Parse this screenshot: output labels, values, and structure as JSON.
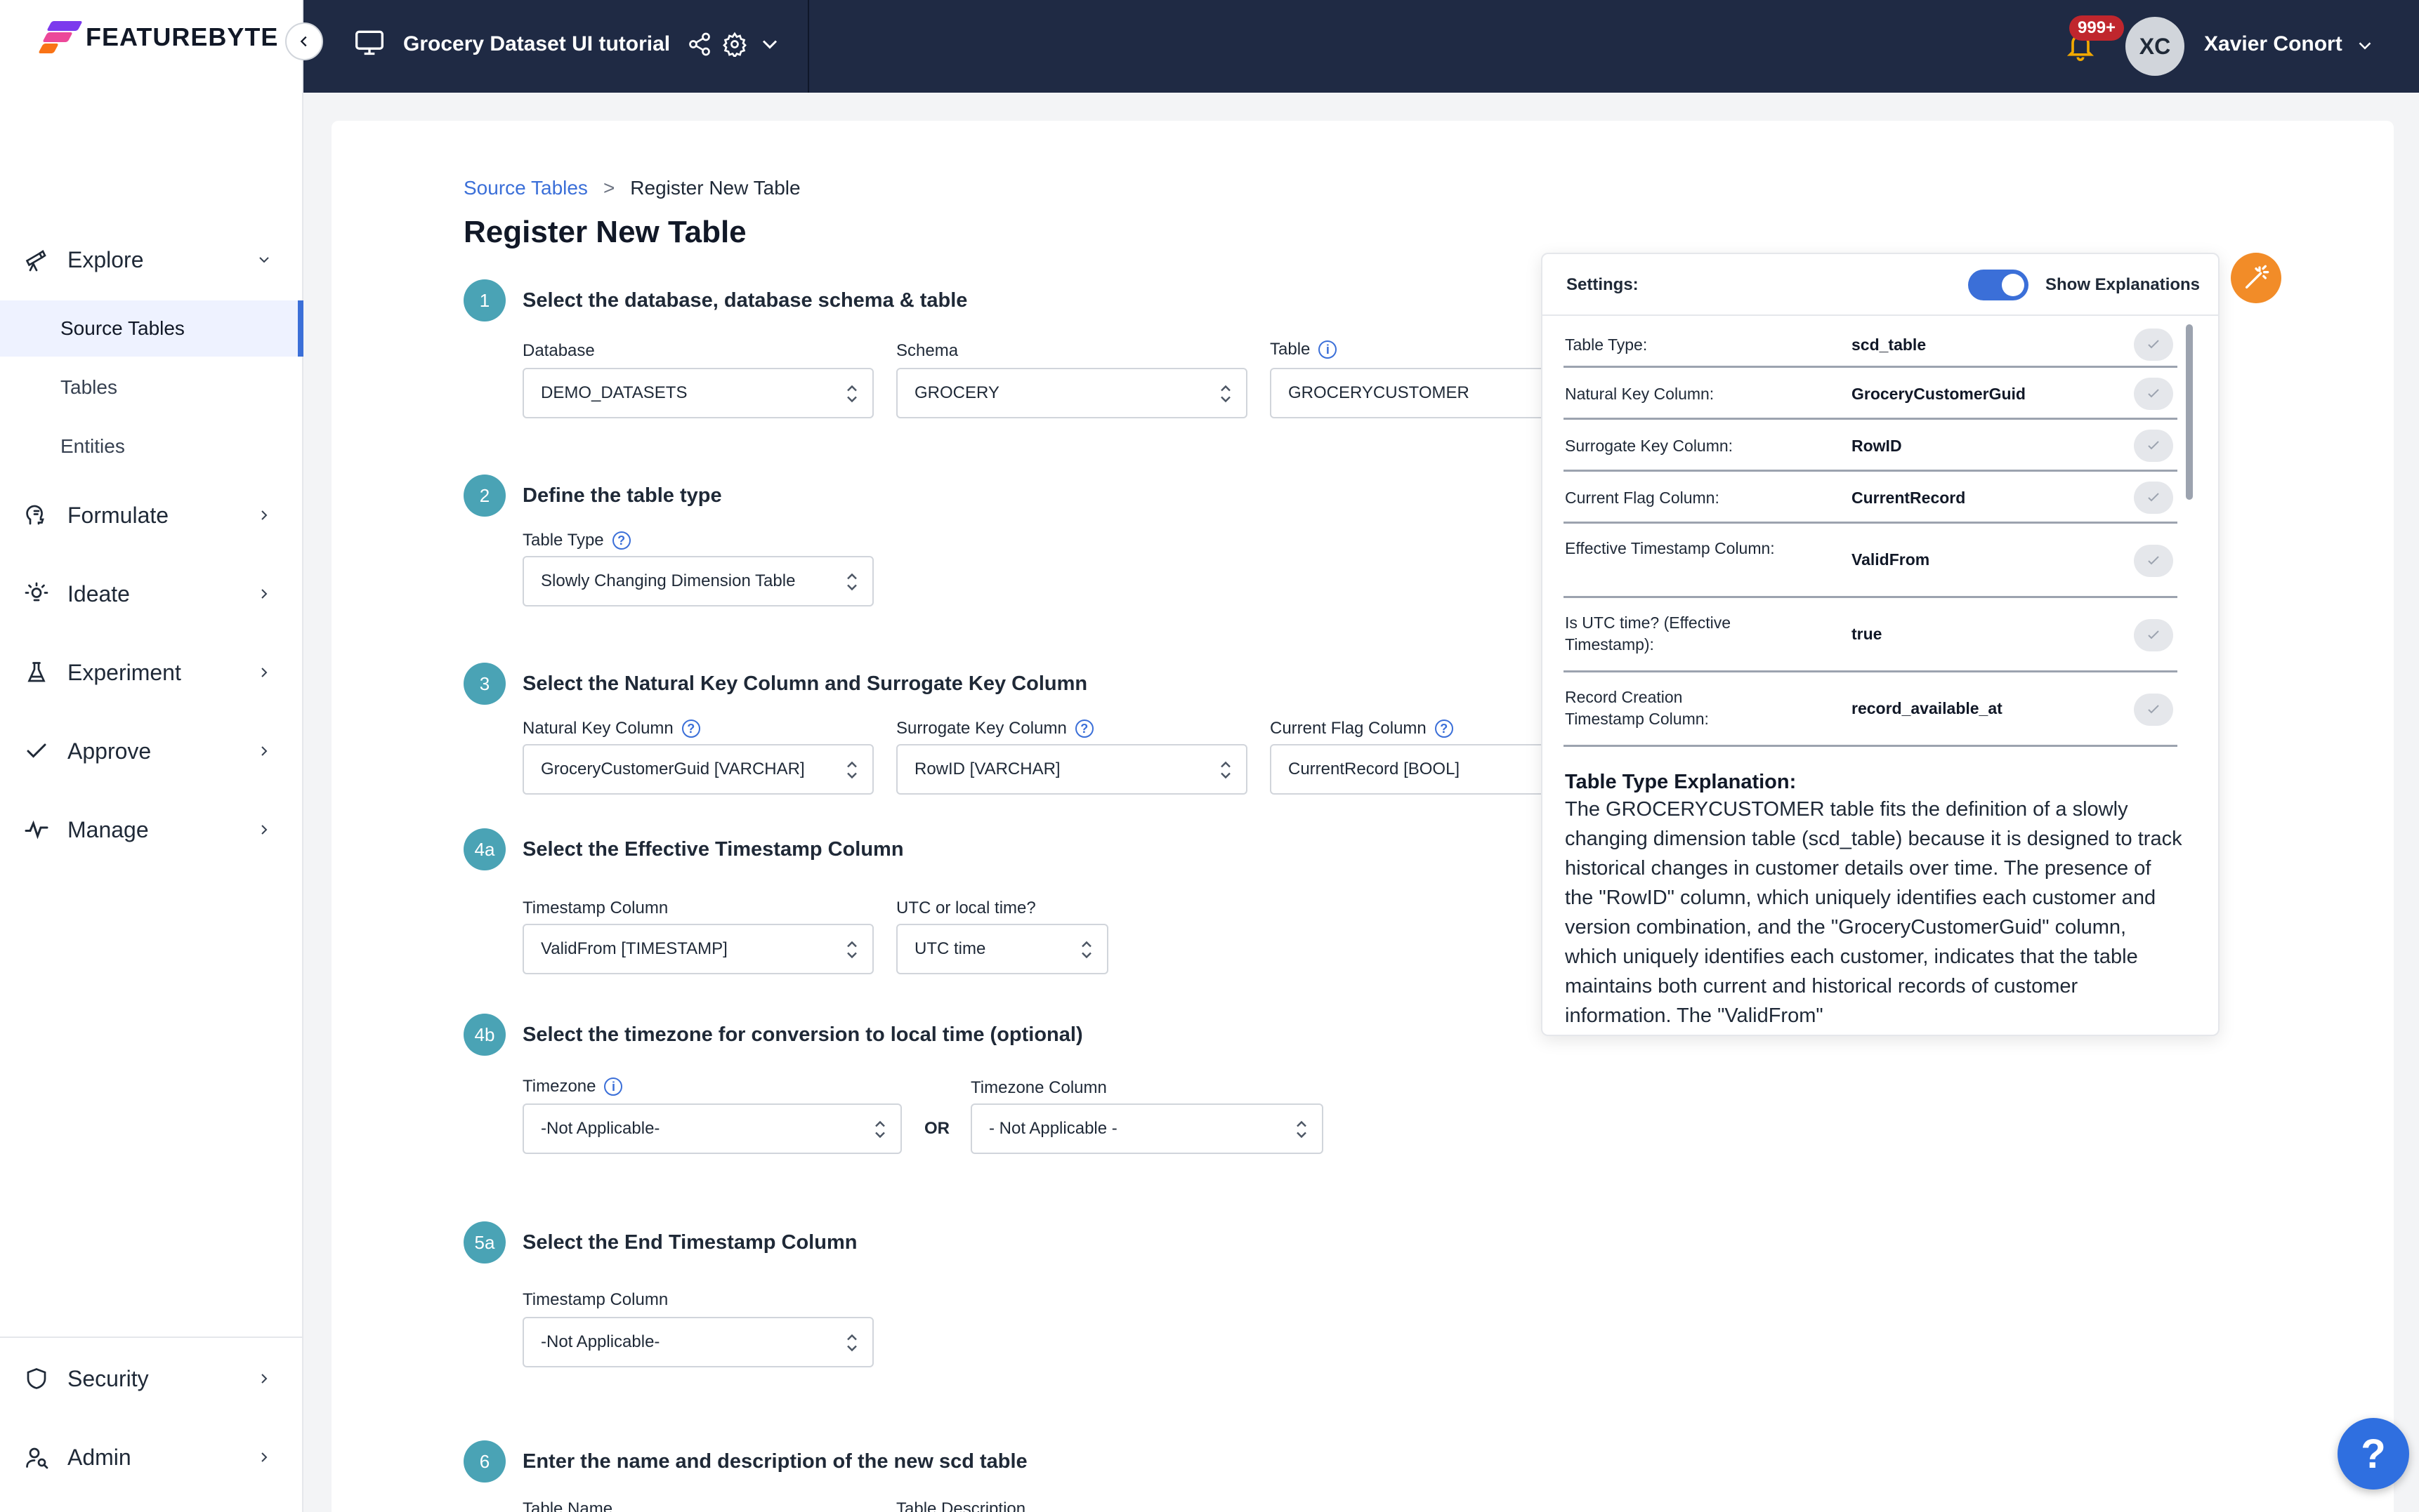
{
  "brand": {
    "logo_text": "FEATUREBYTE"
  },
  "topbar": {
    "project_title": "Grocery Dataset UI tutorial",
    "notification_count": "999+",
    "user_initials": "XC",
    "user_name": "Xavier Conort"
  },
  "sidebar": {
    "explore": "Explore",
    "source_tables": "Source Tables",
    "tables": "Tables",
    "entities": "Entities",
    "formulate": "Formulate",
    "ideate": "Ideate",
    "experiment": "Experiment",
    "approve": "Approve",
    "manage": "Manage",
    "security": "Security",
    "admin": "Admin"
  },
  "breadcrumb": {
    "parent": "Source Tables",
    "separator": ">",
    "current": "Register New Table"
  },
  "page_title": "Register New Table",
  "steps": {
    "s1": {
      "badge": "1",
      "title": "Select the database, database schema & table",
      "database_label": "Database",
      "database_value": "DEMO_DATASETS",
      "schema_label": "Schema",
      "schema_value": "GROCERY",
      "table_label": "Table",
      "table_value": "GROCERYCUSTOMER"
    },
    "s2": {
      "badge": "2",
      "title": "Define the table type",
      "type_label": "Table Type",
      "type_value": "Slowly Changing Dimension Table"
    },
    "s3": {
      "badge": "3",
      "title": "Select the Natural Key Column and Surrogate Key Column",
      "natural_label": "Natural Key Column",
      "natural_value": "GroceryCustomerGuid [VARCHAR]",
      "surrogate_label": "Surrogate Key Column",
      "surrogate_value": "RowID [VARCHAR]",
      "flag_label": "Current Flag Column",
      "flag_value": "CurrentRecord [BOOL]"
    },
    "s4a": {
      "badge": "4a",
      "title": "Select the Effective Timestamp Column",
      "ts_label": "Timestamp Column",
      "ts_value": "ValidFrom  [TIMESTAMP]",
      "utc_label": "UTC or local time?",
      "utc_value": "UTC time"
    },
    "s4b": {
      "badge": "4b",
      "title": "Select the timezone for conversion to local time (optional)",
      "tz_label": "Timezone",
      "tz_value": "-Not Applicable-",
      "or": "OR",
      "tzcol_label": "Timezone Column",
      "tzcol_value": "- Not Applicable -"
    },
    "s5a": {
      "badge": "5a",
      "title": "Select the End Timestamp Column",
      "ts_label": "Timestamp Column",
      "ts_value": "-Not Applicable-"
    },
    "s6": {
      "badge": "6",
      "title": "Enter the name and description of the new scd table",
      "name_label": "Table Name",
      "desc_label": "Table Description"
    }
  },
  "panel": {
    "settings_label": "Settings:",
    "toggle_label": "Show Explanations",
    "rows": [
      {
        "key": "Table Type:",
        "value": "scd_table"
      },
      {
        "key": "Natural Key Column:",
        "value": "GroceryCustomerGuid"
      },
      {
        "key": "Surrogate Key Column:",
        "value": "RowID"
      },
      {
        "key": "Current Flag Column:",
        "value": "CurrentRecord"
      },
      {
        "key": "Effective Timestamp Column:",
        "value": "ValidFrom"
      },
      {
        "key": "Is UTC time? (Effective Timestamp):",
        "value": "true"
      },
      {
        "key": "Record Creation Timestamp Column:",
        "value": "record_available_at"
      }
    ],
    "explanation_title": "Table Type Explanation:",
    "explanation_text": "The GROCERYCUSTOMER table fits the definition of a slowly changing dimension table (scd_table) because it is designed to track historical changes in customer details over time. The presence of the \"RowID\" column, which uniquely identifies each customer and version combination, and the \"GroceryCustomerGuid\" column, which uniquely identifies each customer, indicates that the table maintains both current and historical records of customer information. The \"ValidFrom\""
  },
  "help": {
    "label": "?"
  },
  "colors": {
    "accent": "#3b6fd8",
    "topbar": "#1f2a44",
    "step_badge": "#4aa3b5",
    "wand": "#f28c28",
    "badge": "#c0262d"
  }
}
